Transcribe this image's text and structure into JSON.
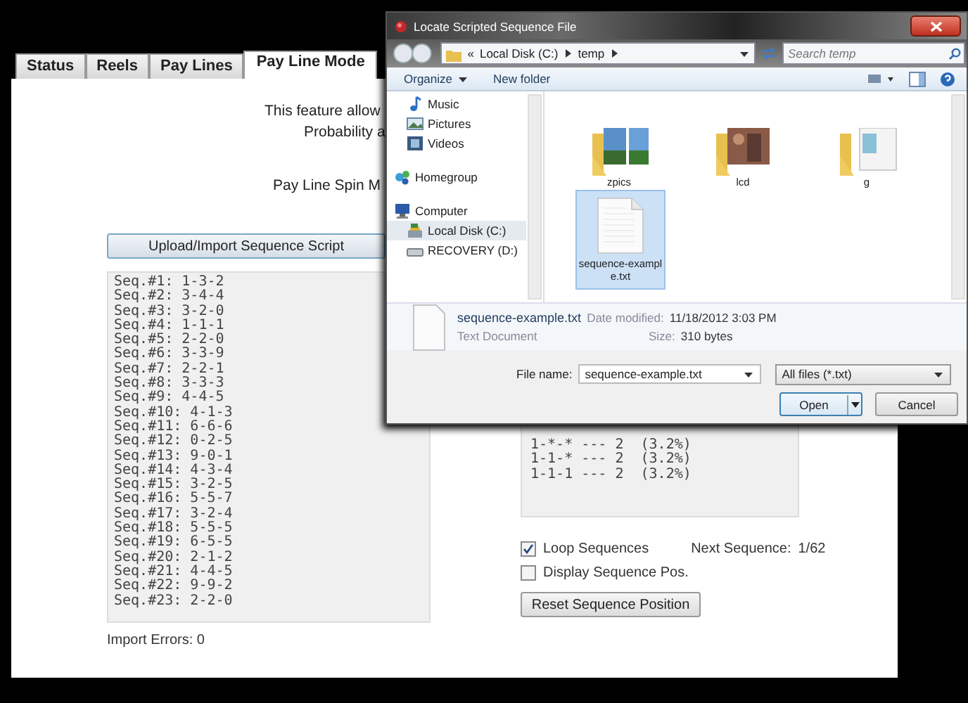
{
  "tabs": [
    {
      "label": "Status",
      "selected": false
    },
    {
      "label": "Reels",
      "selected": false
    },
    {
      "label": "Pay Lines",
      "selected": false
    },
    {
      "label": "Pay Line Mode",
      "selected": true
    }
  ],
  "description": [
    "This feature allow",
    "Probability a"
  ],
  "spin_mode_label": "Pay Line Spin M",
  "upload_button": "Upload/Import Sequence Script",
  "sequences": [
    "Seq.#1: 1-3-2",
    "Seq.#2: 3-4-4",
    "Seq.#3: 3-2-0",
    "Seq.#4: 1-1-1",
    "Seq.#5: 2-2-0",
    "Seq.#6: 3-3-9",
    "Seq.#7: 2-2-1",
    "Seq.#8: 3-3-3",
    "Seq.#9: 4-4-5",
    "Seq.#10: 4-1-3",
    "Seq.#11: 6-6-6",
    "Seq.#12: 0-2-5",
    "Seq.#13: 9-0-1",
    "Seq.#14: 4-3-4",
    "Seq.#15: 3-2-5",
    "Seq.#16: 5-5-7",
    "Seq.#17: 3-2-4",
    "Seq.#18: 5-5-5",
    "Seq.#19: 6-5-5",
    "Seq.#20: 2-1-2",
    "Seq.#21: 4-4-5",
    "Seq.#22: 9-9-2",
    "Seq.#23: 2-2-0"
  ],
  "import_errors": "Import Errors: 0",
  "stats_lines": [
    "1-*-* --- 2  (3.2%)",
    "1-1-* --- 2  (3.2%)",
    "1-1-1 --- 2  (3.2%)"
  ],
  "options": [
    {
      "kind": "checkbox",
      "label": "Loop Sequences",
      "checked": true
    },
    {
      "kind": "checkbox",
      "label": "Display Sequence Pos.",
      "checked": false
    }
  ],
  "next_sequence": {
    "label": "Next Sequence:",
    "value": "1/62"
  },
  "reset_button": "Reset Sequence Position",
  "dialog": {
    "title": "Locate Scripted Sequence File",
    "breadcrumb_prefix": "«",
    "breadcrumb": [
      "Local Disk (C:)",
      "temp"
    ],
    "search": {
      "placeholder": "Search temp"
    },
    "toolbar": [
      {
        "label": "Organize",
        "dropdown": true
      },
      {
        "label": "New folder",
        "dropdown": false
      }
    ],
    "nav": [
      {
        "kind": "music",
        "label": "Music",
        "selected": false
      },
      {
        "kind": "pictures",
        "label": "Pictures",
        "selected": false
      },
      {
        "kind": "videos",
        "label": "Videos",
        "selected": false
      },
      {
        "kind": "homegroup",
        "label": "Homegroup",
        "selected": false
      },
      {
        "kind": "computer",
        "label": "Computer",
        "selected": false
      },
      {
        "kind": "disk",
        "label": "Local Disk (C:)",
        "selected": true
      },
      {
        "kind": "drive",
        "label": "RECOVERY (D:)",
        "selected": false
      }
    ],
    "folders": [
      {
        "label": "zpics"
      },
      {
        "label": "lcd"
      },
      {
        "label": "g"
      }
    ],
    "file": {
      "label_lines": [
        "sequence-exampl",
        "e.txt"
      ],
      "selected": true
    },
    "details": {
      "name": "sequence-example.txt",
      "type": "Text Document",
      "date_label": "Date modified:",
      "date": "11/18/2012 3:03 PM",
      "size_label": "Size:",
      "size": "310 bytes"
    },
    "file_name": {
      "label": "File name:",
      "value": "sequence-example.txt"
    },
    "filter": "All files (*.txt)",
    "buttons": [
      {
        "kind": "split",
        "label": "Open"
      },
      {
        "kind": "plain",
        "label": "Cancel"
      }
    ]
  }
}
